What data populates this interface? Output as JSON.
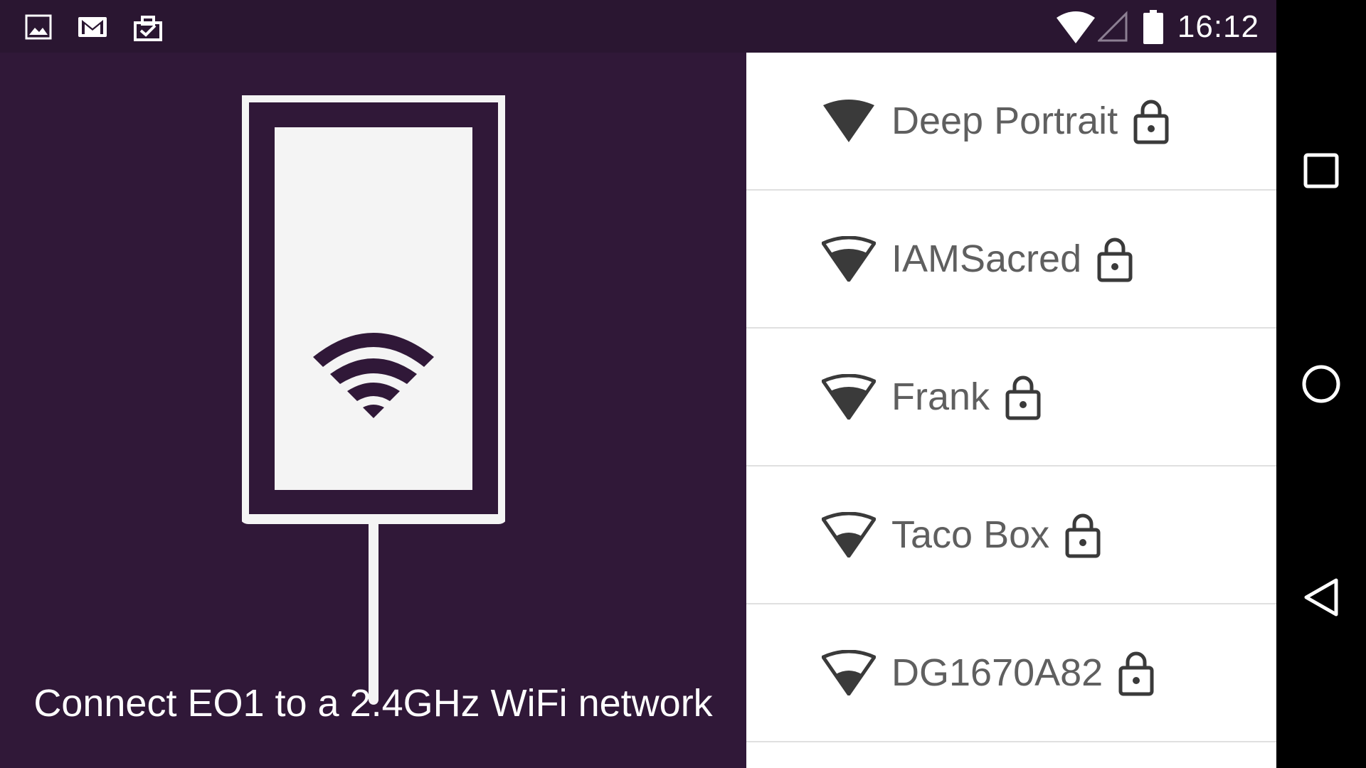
{
  "status_bar": {
    "time": "16:12",
    "left_icons": [
      "image-icon",
      "gmail-icon",
      "clipboard-check-icon"
    ],
    "right_icons": [
      "wifi-icon",
      "cell-signal-icon",
      "battery-icon"
    ]
  },
  "setup": {
    "caption": "Connect EO1 to a 2.4GHz WiFi network",
    "illustration_icon": "wifi-icon"
  },
  "networks": [
    {
      "name": "Deep Portrait",
      "signal": "full",
      "secured": true
    },
    {
      "name": "IAMSacred",
      "signal": "high",
      "secured": true
    },
    {
      "name": "Frank",
      "signal": "high",
      "secured": true
    },
    {
      "name": "Taco Box",
      "signal": "medium",
      "secured": true
    },
    {
      "name": "DG1670A82",
      "signal": "medium",
      "secured": true
    }
  ],
  "nav_bar": {
    "buttons": [
      "recents-icon",
      "home-icon",
      "back-icon"
    ]
  },
  "colors": {
    "status_bar": "#2a1631",
    "left_panel": "#301838",
    "accent_light": "#f4f4f4",
    "network_text": "#5f5f5f",
    "icon_dark": "#3a3a3a"
  }
}
